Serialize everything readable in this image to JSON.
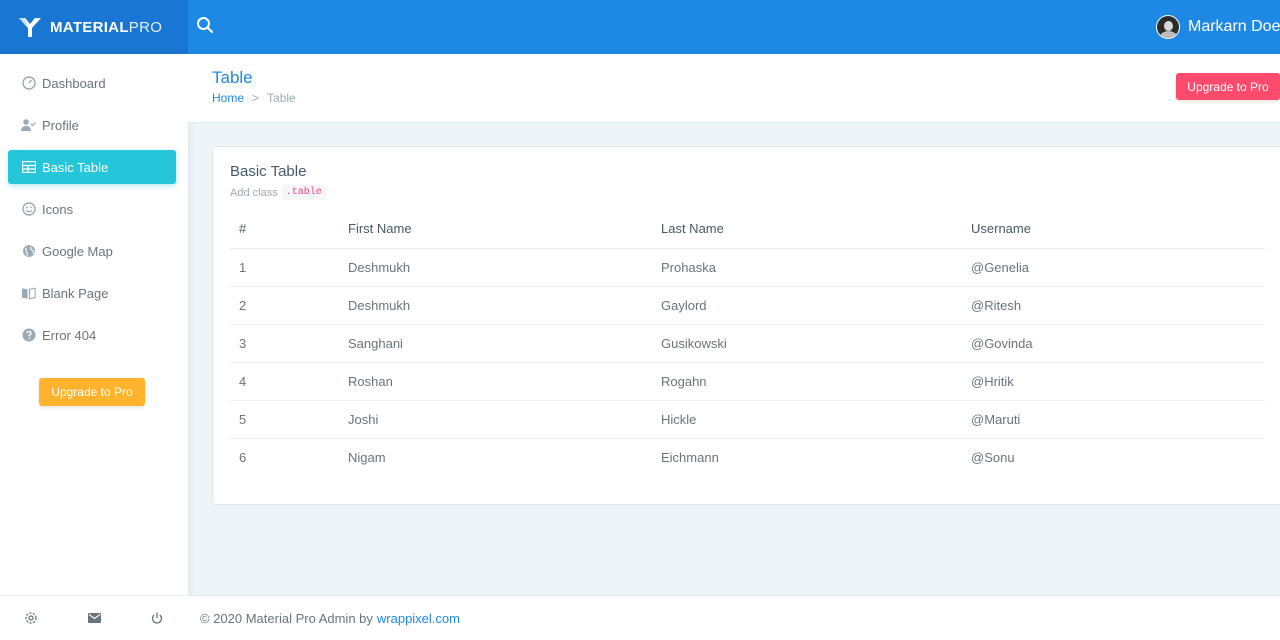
{
  "brand": {
    "name_bold": "MATERIAL",
    "name_light": "PRO"
  },
  "user": {
    "name": "Markarn Doe"
  },
  "sidebar": {
    "items": [
      {
        "label": "Dashboard",
        "icon": "gauge-icon",
        "active": false
      },
      {
        "label": "Profile",
        "icon": "user-check-icon",
        "active": false
      },
      {
        "label": "Basic Table",
        "icon": "table-icon",
        "active": true
      },
      {
        "label": "Icons",
        "icon": "smile-icon",
        "active": false
      },
      {
        "label": "Google Map",
        "icon": "globe-icon",
        "active": false
      },
      {
        "label": "Blank Page",
        "icon": "book-open-icon",
        "active": false
      },
      {
        "label": "Error 404",
        "icon": "help-circle-icon",
        "active": false
      }
    ],
    "upgrade_label": "Upgrade to Pro",
    "footer_icons": [
      "settings-icon",
      "mail-icon",
      "power-icon"
    ]
  },
  "page": {
    "title": "Table",
    "breadcrumb": {
      "home": "Home",
      "separator": ">",
      "current": "Table"
    },
    "upgrade_label": "Upgrade to Pro"
  },
  "card": {
    "title": "Basic Table",
    "subtitle": "Add class",
    "code": ".table"
  },
  "table": {
    "headers": [
      "#",
      "First Name",
      "Last Name",
      "Username"
    ],
    "rows": [
      [
        "1",
        "Deshmukh",
        "Prohaska",
        "@Genelia"
      ],
      [
        "2",
        "Deshmukh",
        "Gaylord",
        "@Ritesh"
      ],
      [
        "3",
        "Sanghani",
        "Gusikowski",
        "@Govinda"
      ],
      [
        "4",
        "Roshan",
        "Rogahn",
        "@Hritik"
      ],
      [
        "5",
        "Joshi",
        "Hickle",
        "@Maruti"
      ],
      [
        "6",
        "Nigam",
        "Eichmann",
        "@Sonu"
      ]
    ]
  },
  "footer": {
    "text": "© 2020 Material Pro Admin by",
    "link": "wrappixel.com"
  },
  "colors": {
    "topbar": "#1e88e5",
    "logo_bg": "#1976d2",
    "active": "#26c6da",
    "upgrade_side": "#ffb22b",
    "upgrade_top": "#fc4b6c"
  }
}
